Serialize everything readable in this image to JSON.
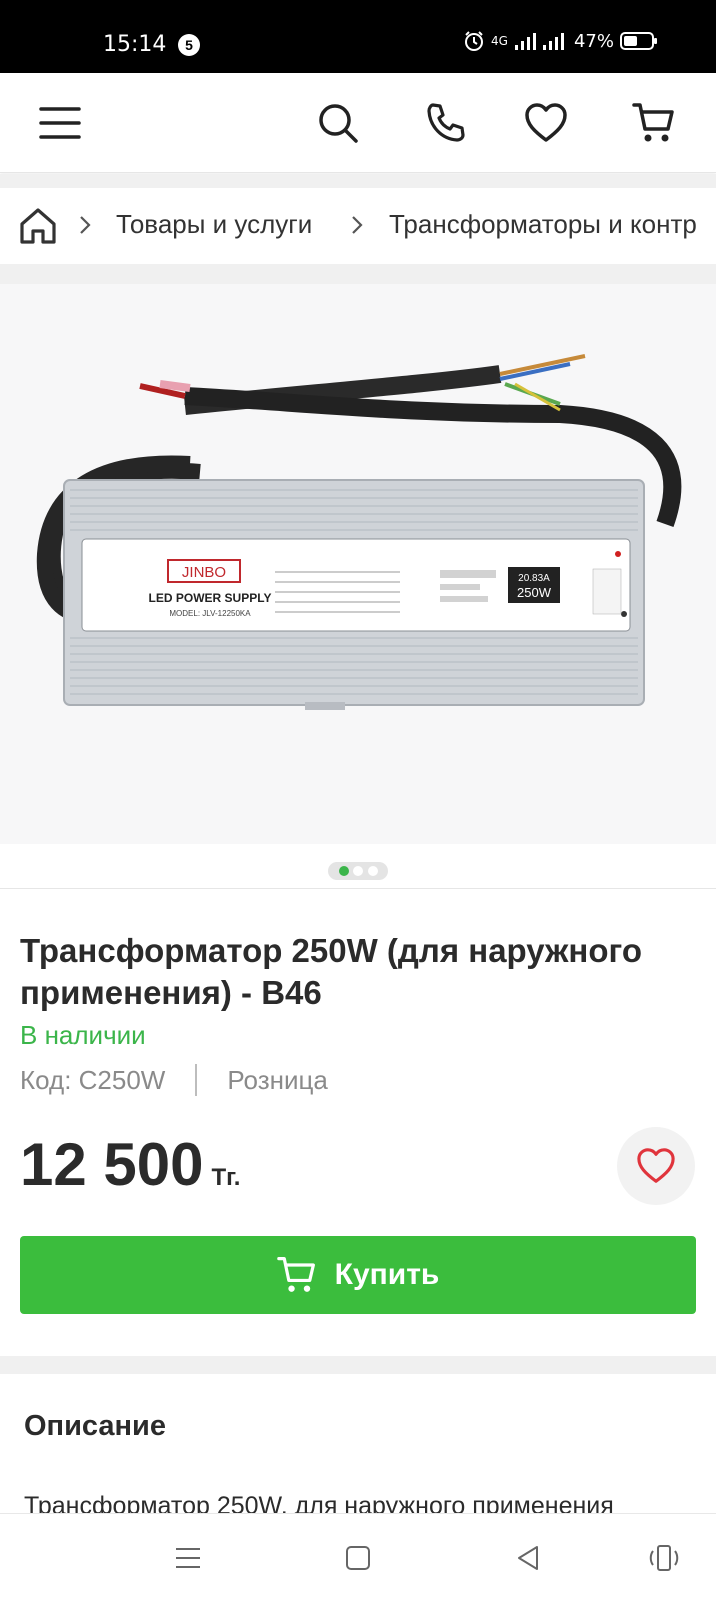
{
  "status_bar": {
    "time": "15:14",
    "notification_count": "5",
    "network": "4G",
    "battery": "47%"
  },
  "icons": {
    "menu": "menu-icon",
    "search": "search-icon",
    "phone": "phone-icon",
    "favorites": "heart-icon",
    "cart": "cart-icon"
  },
  "breadcrumb": {
    "items": [
      "Товары и услуги",
      "Трансформаторы и контр"
    ]
  },
  "gallery": {
    "current": 1,
    "total": 3
  },
  "product": {
    "title": "Трансформатор 250W (для наружного применения) - B46",
    "stock": "В наличии",
    "code": "Код: C250W",
    "price_type": "Розница",
    "price": "12 500",
    "currency": "Тг.",
    "buy_label": "Купить"
  },
  "image_labels": {
    "brand": "JINBO",
    "product": "LED POWER SUPPLY",
    "model": "MODEL: JLV-12250KA",
    "spec_current": "20.83A",
    "spec_power": "250W"
  },
  "description": {
    "title": "Описание",
    "text": "Трансформатор 250W, для наружного применения"
  },
  "colors": {
    "accent": "#3bbd3d",
    "stock": "#3bb54a",
    "favorite": "#e0343c"
  }
}
